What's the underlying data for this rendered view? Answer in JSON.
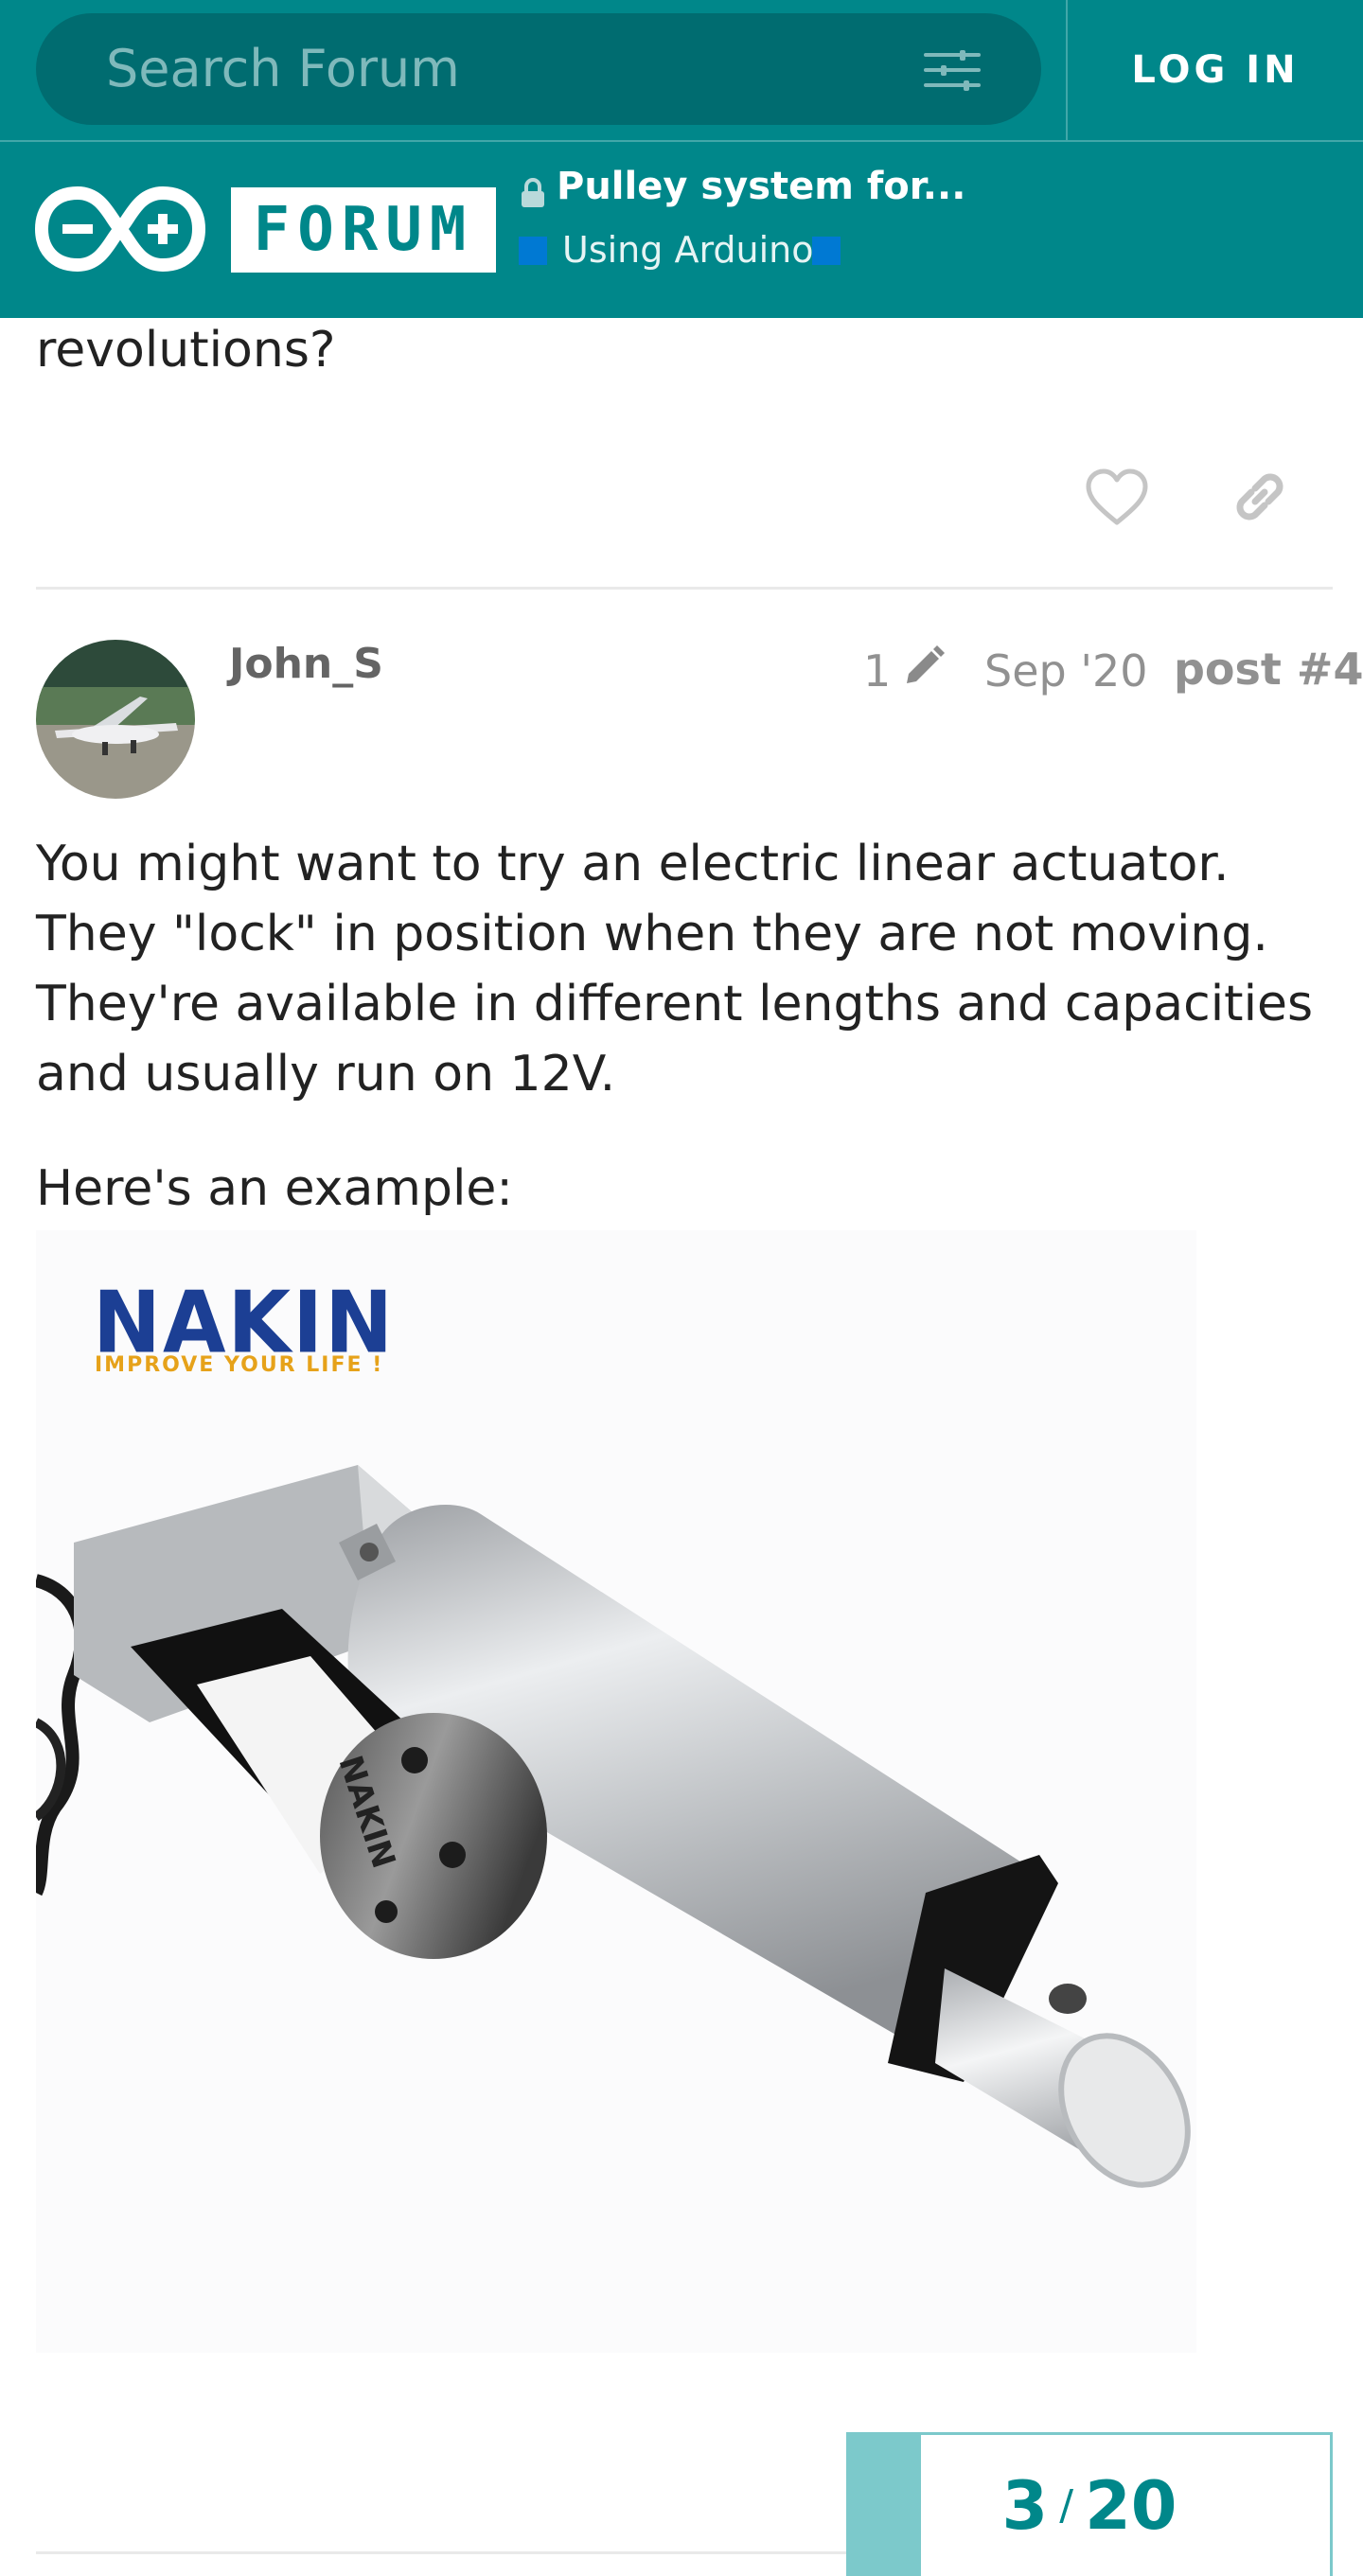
{
  "topbar": {
    "search_placeholder": "Search Forum",
    "filter_icon": "sliders-icon",
    "login_label": "LOG IN"
  },
  "header": {
    "logo_icon": "arduino-logo-icon",
    "forum_label": "FORUM",
    "topic_title": "Pulley system for...",
    "topic_locked": true,
    "category": "Using Arduino",
    "category_color": "#0079d3"
  },
  "previous_post": {
    "text_tail": "revolutions?",
    "actions": [
      "heart-icon",
      "link-icon"
    ]
  },
  "post": {
    "username": "John_S",
    "edit_count": "1",
    "date": "Sep '20",
    "post_number": "post #4",
    "body": [
      "You might want to try an electric linear actuator. They \"lock\" in position when they are not moving. They're available in different lengths and capacities and usually run on 12V."
    ],
    "example_intro": "Here's an example:",
    "image": {
      "brand": "NAKIN",
      "tagline": "IMPROVE YOUR LIFE !",
      "label_text": "NAKIN"
    }
  },
  "progress": {
    "current": "3",
    "separator": "/",
    "total": "20",
    "fraction": 0.15
  },
  "colors": {
    "brand_teal": "#00878a",
    "search_dark": "#006c70",
    "progress_light": "#7cc9cb"
  }
}
